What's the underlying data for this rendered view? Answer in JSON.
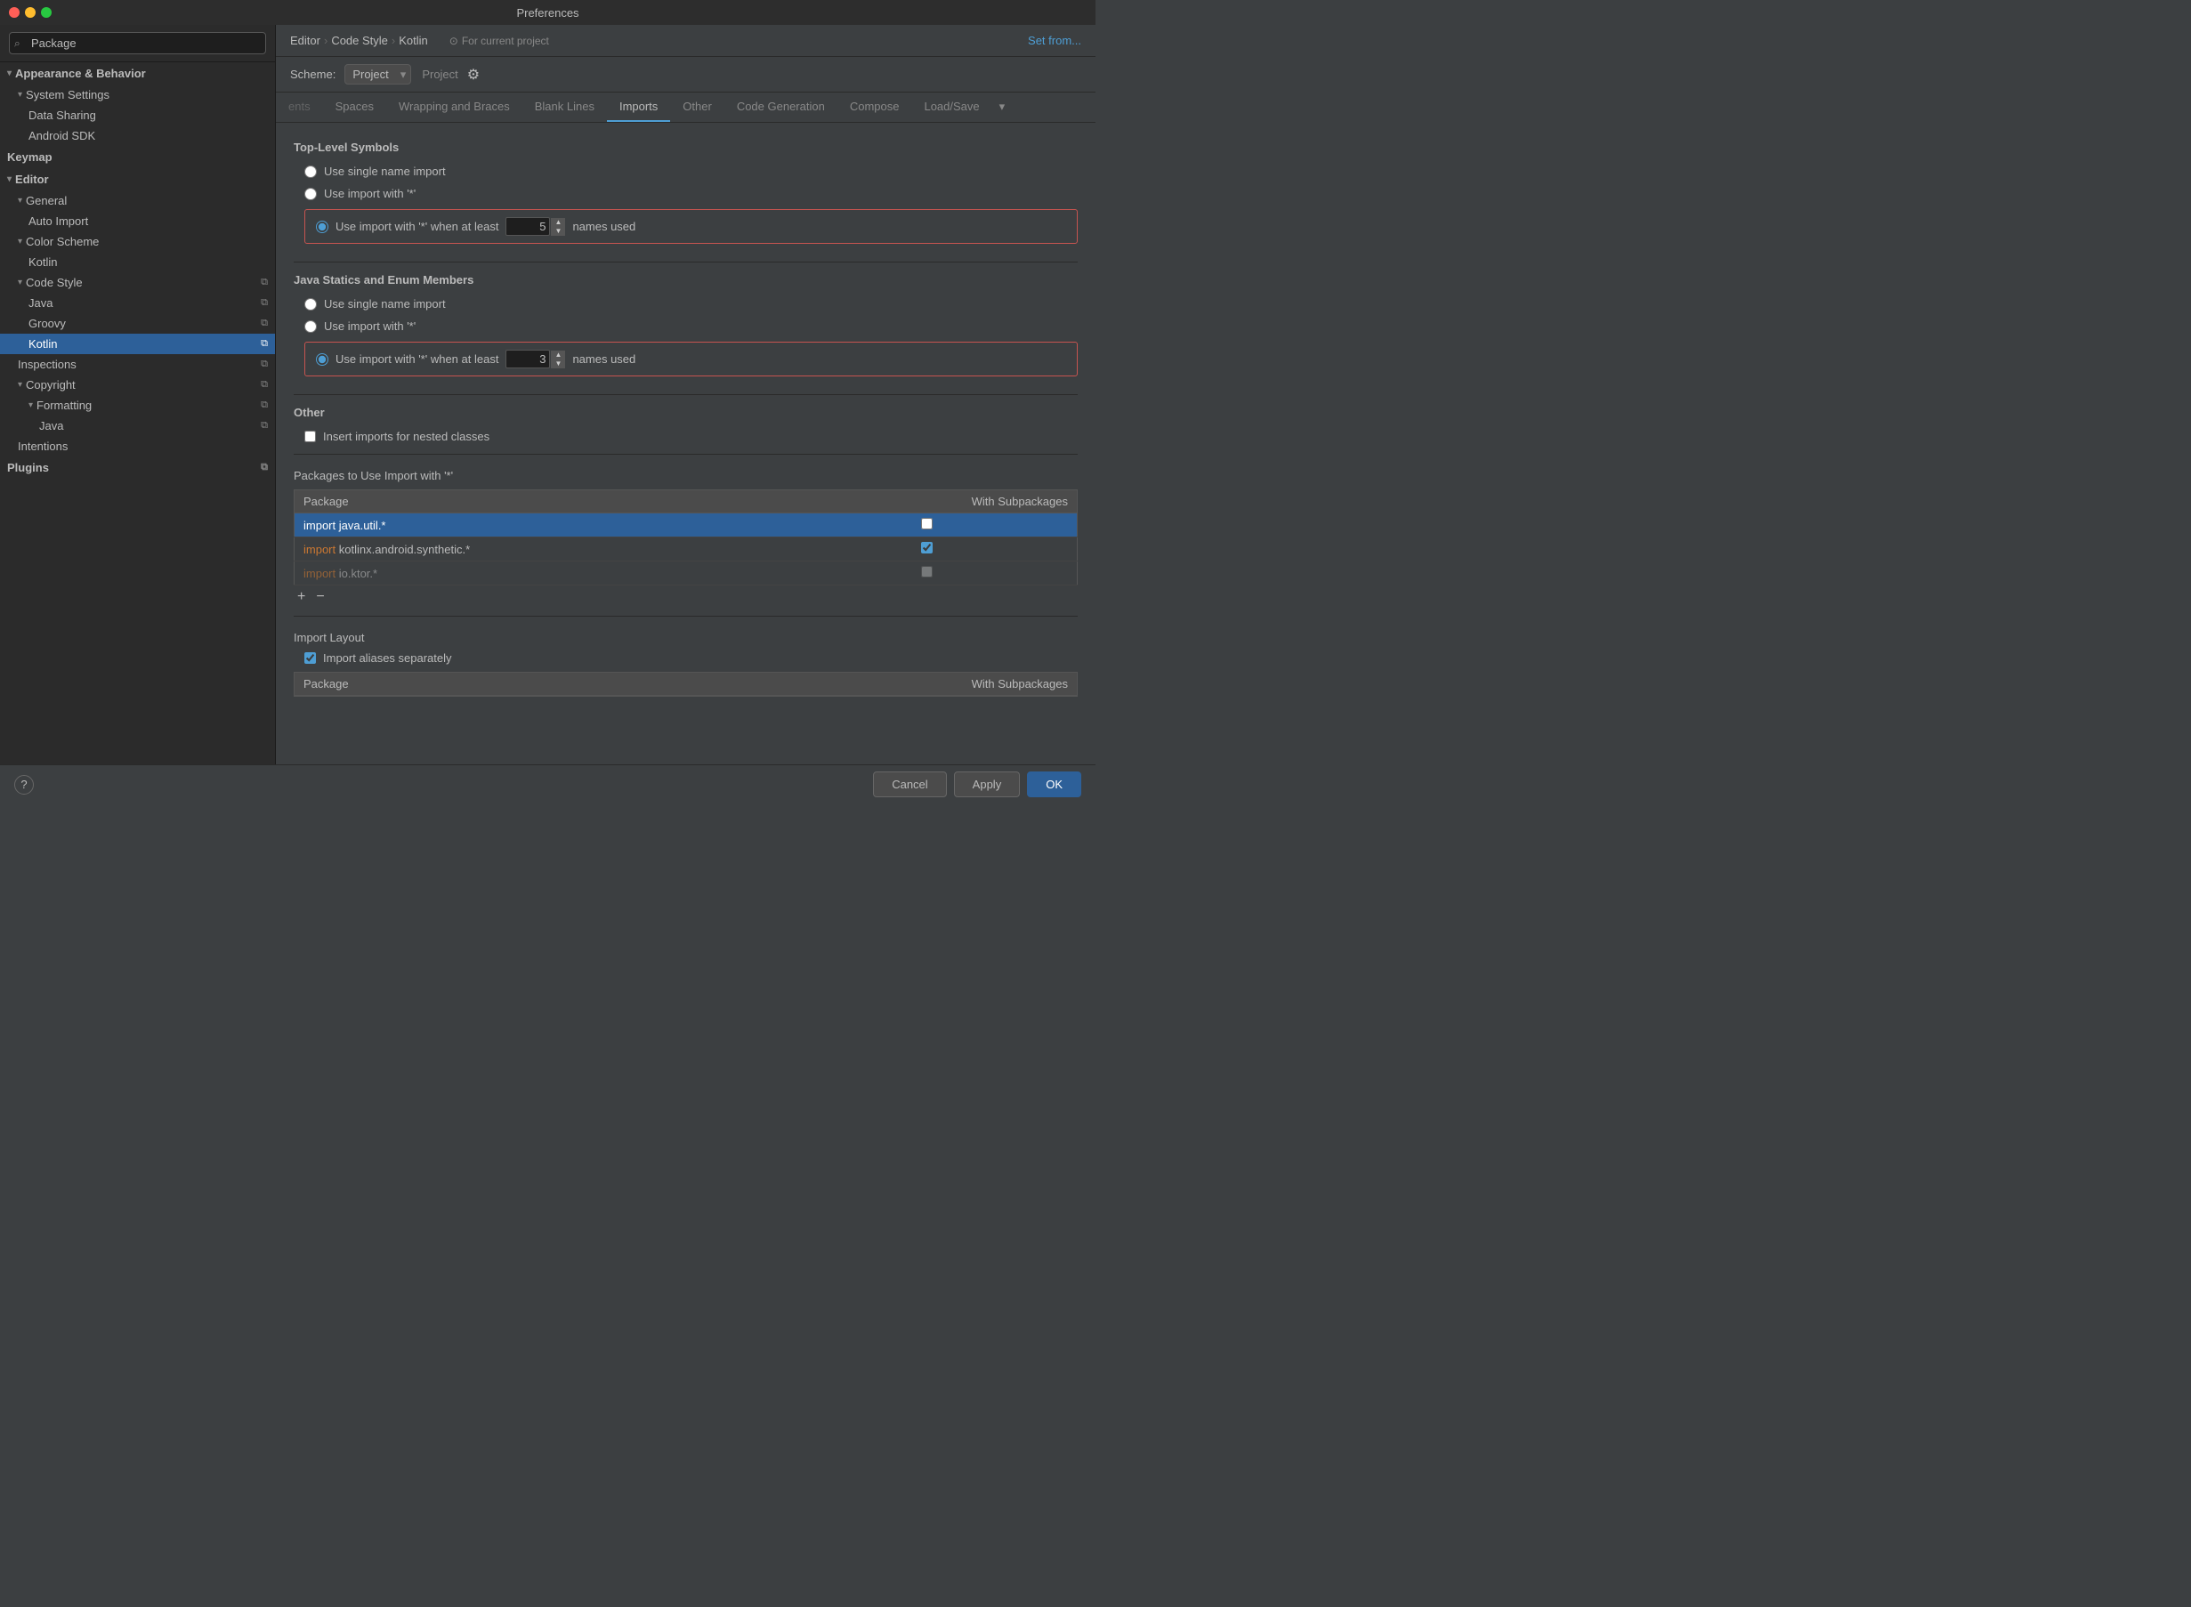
{
  "window": {
    "title": "Preferences"
  },
  "sidebar": {
    "search_placeholder": "Package",
    "items": [
      {
        "id": "appearance-behavior",
        "label": "Appearance & Behavior",
        "level": 0,
        "type": "section-expand",
        "expanded": true
      },
      {
        "id": "system-settings",
        "label": "System Settings",
        "level": 1,
        "type": "expand",
        "expanded": true
      },
      {
        "id": "data-sharing",
        "label": "Data Sharing",
        "level": 2,
        "type": "item"
      },
      {
        "id": "android-sdk",
        "label": "Android SDK",
        "level": 2,
        "type": "item"
      },
      {
        "id": "keymap",
        "label": "Keymap",
        "level": 0,
        "type": "bold-item"
      },
      {
        "id": "editor",
        "label": "Editor",
        "level": 0,
        "type": "section-expand",
        "expanded": true
      },
      {
        "id": "general",
        "label": "General",
        "level": 1,
        "type": "expand",
        "expanded": true
      },
      {
        "id": "auto-import",
        "label": "Auto Import",
        "level": 2,
        "type": "item"
      },
      {
        "id": "color-scheme",
        "label": "Color Scheme",
        "level": 1,
        "type": "expand",
        "expanded": true
      },
      {
        "id": "kotlin-color",
        "label": "Kotlin",
        "level": 2,
        "type": "item"
      },
      {
        "id": "code-style",
        "label": "Code Style",
        "level": 1,
        "type": "expand-copy",
        "expanded": true
      },
      {
        "id": "java",
        "label": "Java",
        "level": 2,
        "type": "item-copy"
      },
      {
        "id": "groovy",
        "label": "Groovy",
        "level": 2,
        "type": "item-copy"
      },
      {
        "id": "kotlin",
        "label": "Kotlin",
        "level": 2,
        "type": "item-copy",
        "selected": true
      },
      {
        "id": "inspections",
        "label": "Inspections",
        "level": 1,
        "type": "item-copy"
      },
      {
        "id": "copyright",
        "label": "Copyright",
        "level": 1,
        "type": "expand-copy",
        "expanded": true
      },
      {
        "id": "formatting",
        "label": "Formatting",
        "level": 2,
        "type": "expand-copy",
        "expanded": true
      },
      {
        "id": "java-formatting",
        "label": "Java",
        "level": 3,
        "type": "item-copy"
      },
      {
        "id": "intentions",
        "label": "Intentions",
        "level": 1,
        "type": "item"
      },
      {
        "id": "plugins",
        "label": "Plugins",
        "level": 0,
        "type": "bold-item-copy"
      }
    ]
  },
  "breadcrumb": {
    "parts": [
      "Editor",
      "Code Style",
      "Kotlin"
    ],
    "for_project": "For current project"
  },
  "scheme": {
    "label": "Scheme:",
    "value": "Project",
    "secondary_text": "Project"
  },
  "set_from": "Set from...",
  "tabs": [
    {
      "id": "tab-ents",
      "label": "ents",
      "active": false
    },
    {
      "id": "tab-spaces",
      "label": "Spaces",
      "active": false
    },
    {
      "id": "tab-wrapping",
      "label": "Wrapping and Braces",
      "active": false
    },
    {
      "id": "tab-blank-lines",
      "label": "Blank Lines",
      "active": false
    },
    {
      "id": "tab-imports",
      "label": "Imports",
      "active": true
    },
    {
      "id": "tab-other",
      "label": "Other",
      "active": false
    },
    {
      "id": "tab-code-gen",
      "label": "Code Generation",
      "active": false
    },
    {
      "id": "tab-compose",
      "label": "Compose",
      "active": false
    },
    {
      "id": "tab-load-save",
      "label": "Load/Save",
      "active": false
    }
  ],
  "top_level_symbols": {
    "title": "Top-Level Symbols",
    "options": [
      {
        "id": "tls-single",
        "label": "Use single name import",
        "checked": false
      },
      {
        "id": "tls-star",
        "label": "Use import with '*'",
        "checked": false
      },
      {
        "id": "tls-star-least",
        "label": "Use import with '*' when at least",
        "checked": true,
        "value": "5",
        "suffix": "names used"
      }
    ]
  },
  "java_statics": {
    "title": "Java Statics and Enum Members",
    "options": [
      {
        "id": "js-single",
        "label": "Use single name import",
        "checked": false
      },
      {
        "id": "js-star",
        "label": "Use import with '*'",
        "checked": false
      },
      {
        "id": "js-star-least",
        "label": "Use import with '*' when at least",
        "checked": true,
        "value": "3",
        "suffix": "names used"
      }
    ]
  },
  "other": {
    "title": "Other",
    "options": [
      {
        "id": "insert-imports-nested",
        "label": "Insert imports for nested classes",
        "checked": false
      }
    ]
  },
  "packages_table": {
    "title": "Packages to Use Import with '*'",
    "columns": [
      "Package",
      "With Subpackages"
    ],
    "rows": [
      {
        "package": "import java.util.*",
        "with_subpackages": false,
        "selected": true,
        "import_style": "plain"
      },
      {
        "package": "kotlinx.android.synthetic.*",
        "with_subpackages": true,
        "selected": false,
        "import_style": "highlighted",
        "import_kw": "import "
      },
      {
        "package": "io.ktor.*",
        "with_subpackages": true,
        "selected": false,
        "import_style": "highlighted-faded",
        "import_kw": "import "
      }
    ],
    "add_label": "+",
    "remove_label": "−"
  },
  "import_layout": {
    "title": "Import Layout",
    "checkbox_label": "Import aliases separately",
    "checkbox_checked": true,
    "bottom_table": {
      "col1": "Package",
      "col2": "With Subpackages"
    }
  },
  "footer": {
    "help_label": "?",
    "cancel_label": "Cancel",
    "apply_label": "Apply",
    "ok_label": "OK"
  }
}
